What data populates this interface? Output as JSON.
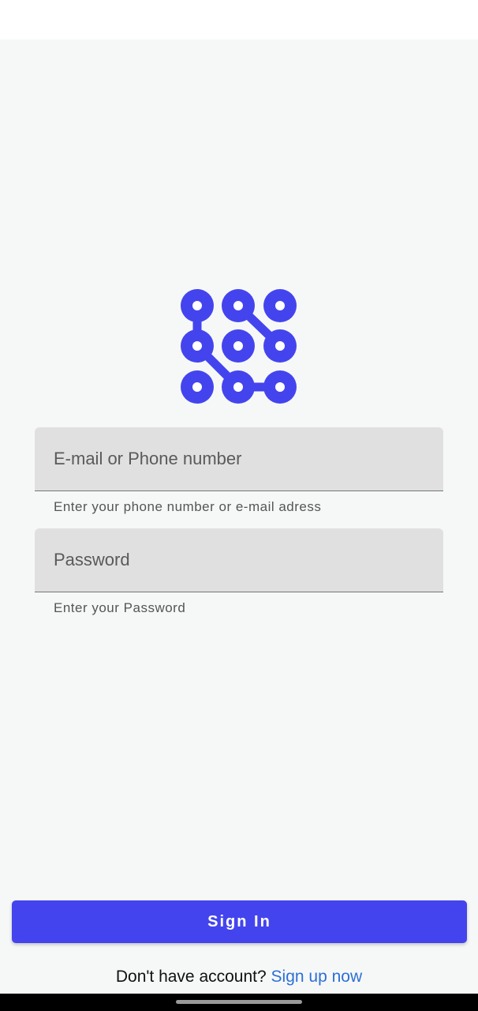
{
  "login": {
    "logo_icon": "pattern-lock-icon",
    "brand_color": "#4444ee",
    "email": {
      "placeholder": "E-mail or Phone number",
      "value": "",
      "helper": "Enter your phone number or e-mail adress"
    },
    "password": {
      "placeholder": "Password",
      "value": "",
      "helper": "Enter your Password"
    },
    "sign_in_label": "Sign In",
    "signup_prompt": "Don't have account?",
    "signup_link": "Sign up now",
    "link_color": "#2d6fd6"
  }
}
